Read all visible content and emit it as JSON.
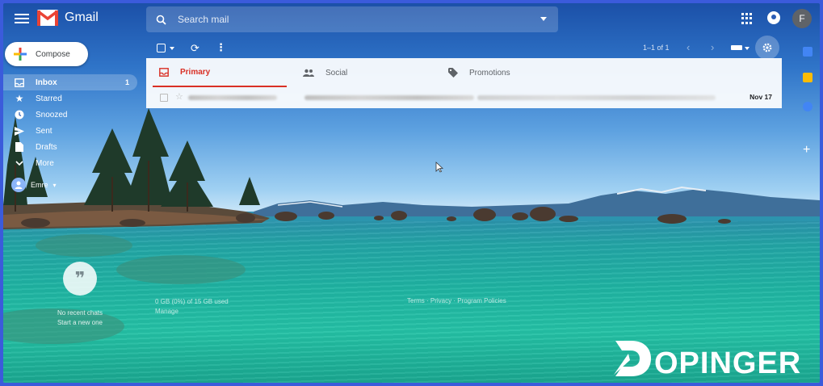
{
  "app": {
    "name": "Gmail",
    "brand_red": "#EA4335",
    "accent_blue": "#1a73e8"
  },
  "search": {
    "placeholder": "Search mail"
  },
  "account": {
    "avatar_letter": "F"
  },
  "toolbar": {
    "pagination": "1–1 of 1"
  },
  "compose": {
    "label": "Compose"
  },
  "sidebar": {
    "items": [
      {
        "label": "Inbox",
        "icon": "inbox-icon",
        "count": "1",
        "active": true
      },
      {
        "label": "Starred",
        "icon": "star-icon"
      },
      {
        "label": "Snoozed",
        "icon": "clock-icon"
      },
      {
        "label": "Sent",
        "icon": "send-icon"
      },
      {
        "label": "Drafts",
        "icon": "draft-icon"
      },
      {
        "label": "More",
        "icon": "chevron-down-icon"
      }
    ],
    "user_label": "Emre"
  },
  "tabs": [
    {
      "label": "Primary",
      "icon": "inbox-icon",
      "color": "#d93025"
    },
    {
      "label": "Social",
      "icon": "people-icon"
    },
    {
      "label": "Promotions",
      "icon": "tag-icon"
    }
  ],
  "emails": [
    {
      "date": "Nov 17"
    }
  ],
  "hangouts": {
    "line1": "No recent chats",
    "line2": "Start a new one"
  },
  "footer": {
    "storage": "0 GB (0%) of 15 GB used",
    "manage": "Manage",
    "links": "Terms · Privacy · Program Policies"
  },
  "watermark": {
    "text": "DOPINGER"
  }
}
